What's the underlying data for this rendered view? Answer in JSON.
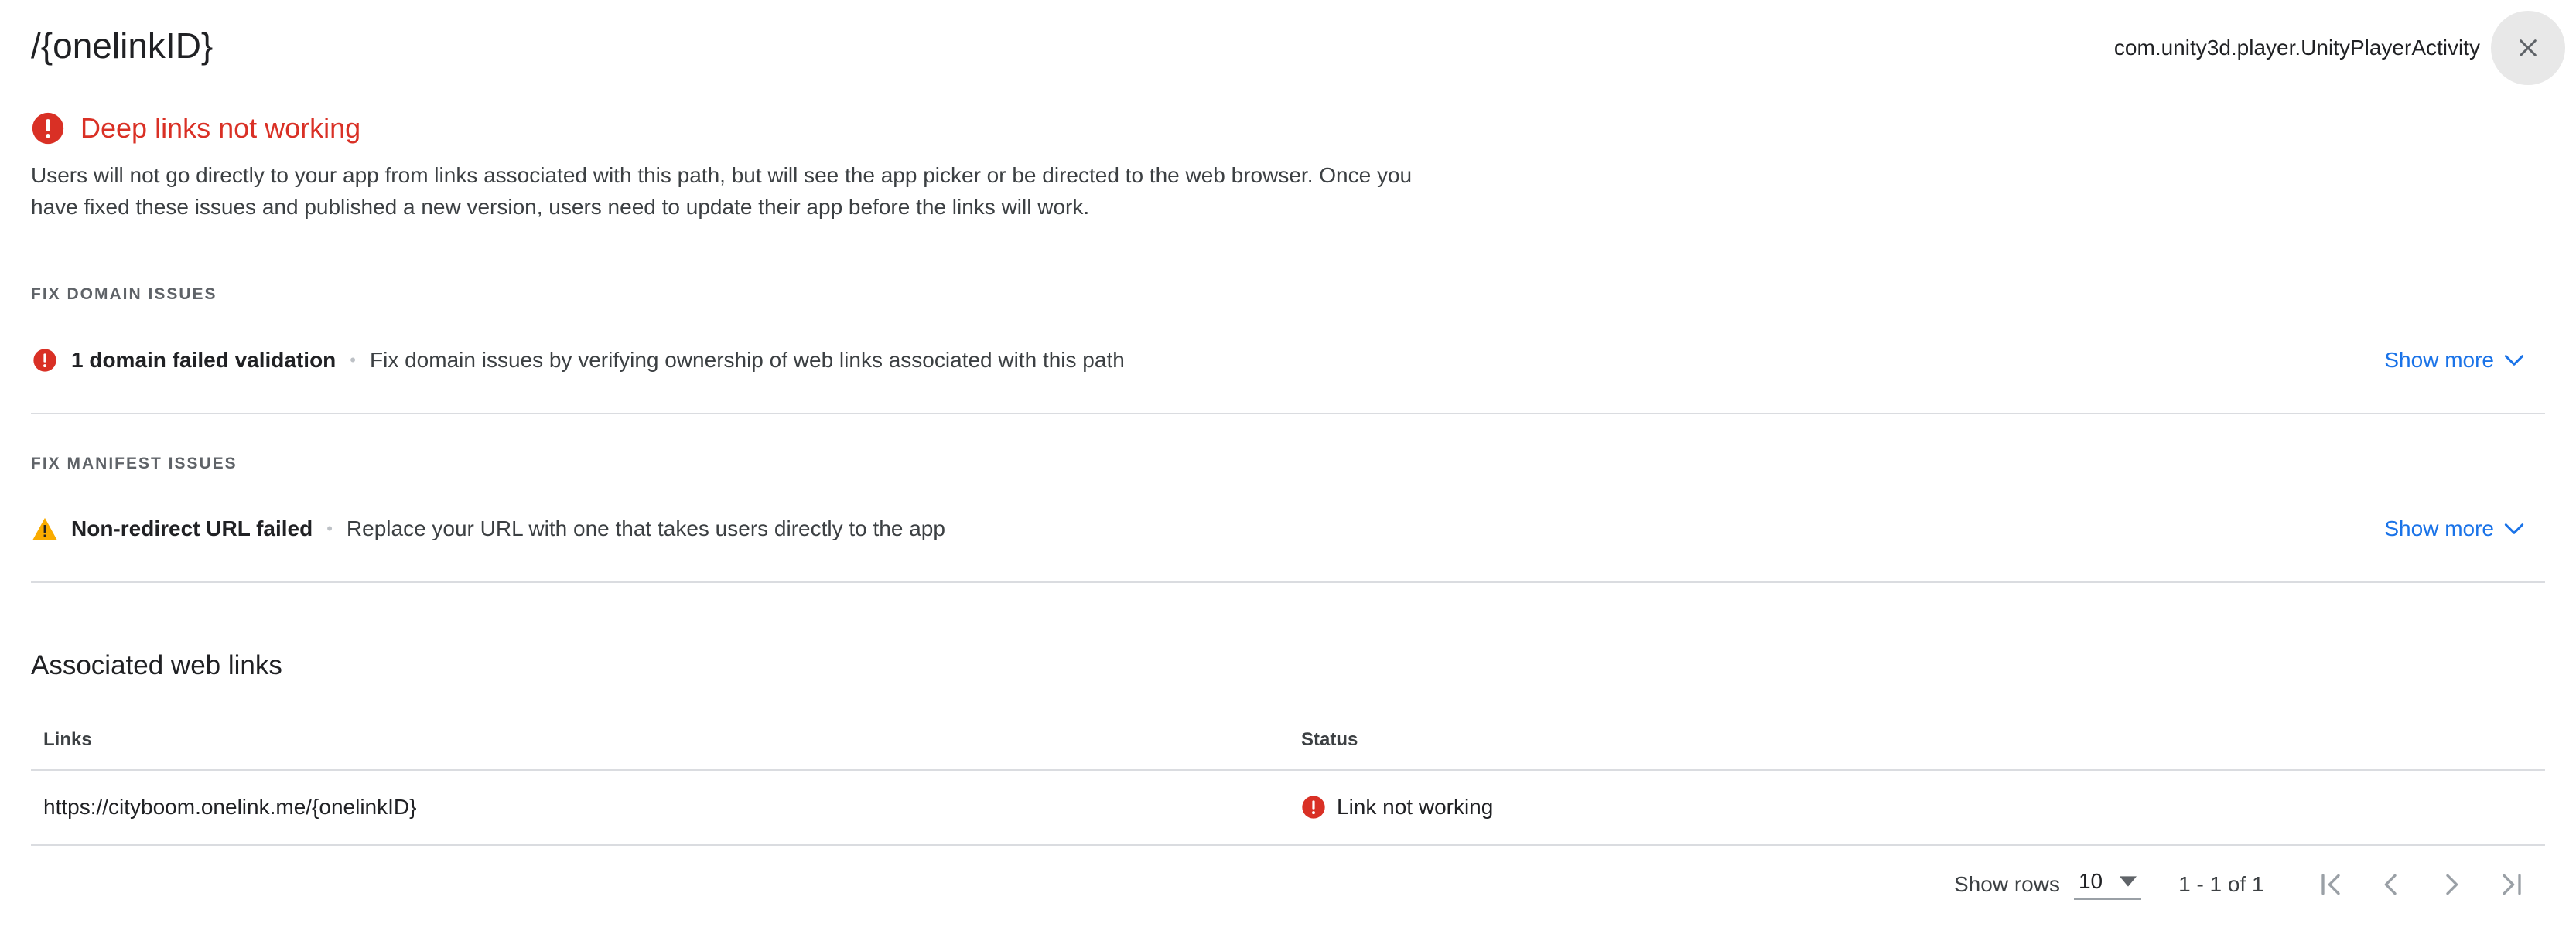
{
  "header": {
    "title": "/{onelinkID}",
    "activity": "com.unity3d.player.UnityPlayerActivity",
    "close_icon": "close-icon"
  },
  "alert": {
    "heading": "Deep links not working",
    "description": "Users will not go directly to your app from links associated with this path, but will see the app picker or be directed to the web browser. Once you have fixed these issues and published a new version, users need to update their app before the links will work.",
    "color": "#d93025"
  },
  "domain_section": {
    "label": "FIX DOMAIN ISSUES",
    "issue_title": "1 domain failed validation",
    "separator": "•",
    "issue_desc": "Fix domain issues by verifying ownership of web links associated with this path",
    "show_more": "Show more"
  },
  "manifest_section": {
    "label": "FIX MANIFEST ISSUES",
    "issue_title": "Non-redirect URL failed",
    "separator": "•",
    "issue_desc": "Replace your URL with one that takes users directly to the app",
    "show_more": "Show more"
  },
  "web_links": {
    "heading": "Associated web links",
    "columns": [
      "Links",
      "Status"
    ],
    "rows": [
      {
        "link": "https://cityboom.onelink.me/{onelinkID}",
        "status": "Link not working"
      }
    ]
  },
  "pagination": {
    "show_rows_label": "Show rows",
    "rows_value": "10",
    "range": "1 - 1 of 1"
  },
  "colors": {
    "error": "#d93025",
    "warning": "#f9ab00",
    "link": "#1a73e8"
  }
}
